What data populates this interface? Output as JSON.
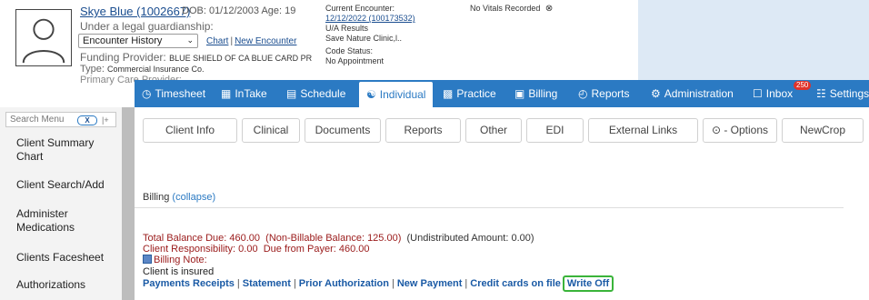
{
  "patient": {
    "name": "Skye Blue (1002667)",
    "dob_age": "DOB: 01/12/2003 Age: 19",
    "guardianship": "Under a legal guardianship:",
    "history_select": "Encounter History",
    "chart_link": "Chart",
    "new_encounter_link": "New Encounter",
    "funding_label": "Funding Provider:",
    "funding_value": "BLUE SHIELD OF CA BLUE CARD PR",
    "type_label": "Type:",
    "type_value": "Commercial Insurance Co.",
    "pcp_label": "Primary Care Provider:"
  },
  "encounter": {
    "label": "Current Encounter:",
    "link": "12/12/2022 (100173532)",
    "ua": "U/A Results",
    "clinic": "Save Nature Clinic,l..",
    "code_status": "Code Status:",
    "appointment": "No Appointment"
  },
  "vitals": {
    "text": "No Vitals Recorded",
    "icon": "circle-x-icon"
  },
  "nav": [
    {
      "label": "Timesheet",
      "icon": "clock-icon"
    },
    {
      "label": "InTake",
      "icon": "intake-icon"
    },
    {
      "label": "Schedule",
      "icon": "calendar-icon"
    },
    {
      "label": "Individual",
      "icon": "person-icon"
    },
    {
      "label": "Practice",
      "icon": "practice-icon"
    },
    {
      "label": "Billing",
      "icon": "dollar-icon"
    },
    {
      "label": "Reports",
      "icon": "pie-chart-icon"
    },
    {
      "label": "Administration",
      "icon": "gear-icon"
    },
    {
      "label": "Inbox",
      "icon": "inbox-icon",
      "badge": "250"
    },
    {
      "label": "Settings",
      "icon": "sliders-icon"
    }
  ],
  "sidebar": {
    "search_placeholder": "Search Menu",
    "clear": "X",
    "collapse": "|+",
    "items": [
      "Client Summary Chart",
      "Client Search/Add",
      "Administer Medications",
      "Clients Facesheet",
      "Authorizations"
    ]
  },
  "tabs": [
    "Client Info",
    "Clinical",
    "Documents",
    "Reports",
    "Other",
    "EDI",
    "External Links",
    "⊙ - Options",
    "NewCrop"
  ],
  "billing": {
    "title": "Billing",
    "collapse": "(collapse)",
    "total": "Total Balance Due: 460.00",
    "non_billable": "(Non-Billable Balance: 125.00)",
    "undistributed": "(Undistributed Amount: 0.00)",
    "client_resp": "Client Responsibility: 0.00",
    "payer": "Due from Payer: 460.00",
    "note_label": "Billing Note:",
    "insured": "Client is insured",
    "links": [
      "Payments Receipts",
      "Statement",
      "Prior Authorization",
      "New Payment",
      "Credit cards on file"
    ],
    "write_off": "Write Off"
  },
  "colors": {
    "nav_bg": "#2b7ac3",
    "highlight": "#3ab43a",
    "badge": "#e0322a"
  }
}
